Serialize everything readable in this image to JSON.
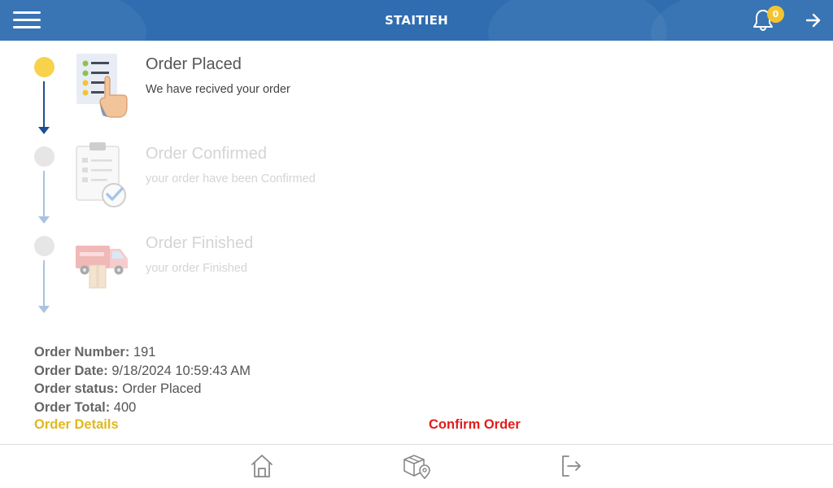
{
  "header": {
    "title": "STAITIEH",
    "notification_count": "0",
    "menu_icon": "hamburger-menu-icon",
    "bell_icon": "bell-icon",
    "forward_icon": "arrow-right-icon",
    "background_color": "#2f6db0"
  },
  "steps": [
    {
      "title": "Order Placed",
      "description": "We have recived your order",
      "status": "active",
      "icon": "order-list-hand-icon"
    },
    {
      "title": "Order Confirmed",
      "description": "your order have been Confirmed",
      "status": "inactive",
      "icon": "clipboard-check-icon"
    },
    {
      "title": "Order Finished",
      "description": "your order Finished",
      "status": "inactive",
      "icon": "delivery-truck-icon"
    }
  ],
  "order": {
    "number_label": "Order Number:",
    "number_value": "191",
    "date_label": "Order Date:",
    "date_value": "9/18/2024 10:59:43 AM",
    "status_label": "Order status:",
    "status_value": "Order Placed",
    "total_label": "Order Total:",
    "total_value": "400"
  },
  "actions": {
    "details_label": "Order Details",
    "confirm_label": "Confirm Order",
    "details_color": "#e0b81c",
    "confirm_color": "#e41b1b"
  },
  "bottom_nav": {
    "items": [
      {
        "icon": "home-icon"
      },
      {
        "icon": "package-location-icon"
      },
      {
        "icon": "logout-icon"
      }
    ]
  },
  "colors": {
    "active_dot": "#f7d24a",
    "active_line": "#1d4f91",
    "inactive_dot": "#e6e6e6",
    "inactive_line": "#a9c3e0"
  }
}
